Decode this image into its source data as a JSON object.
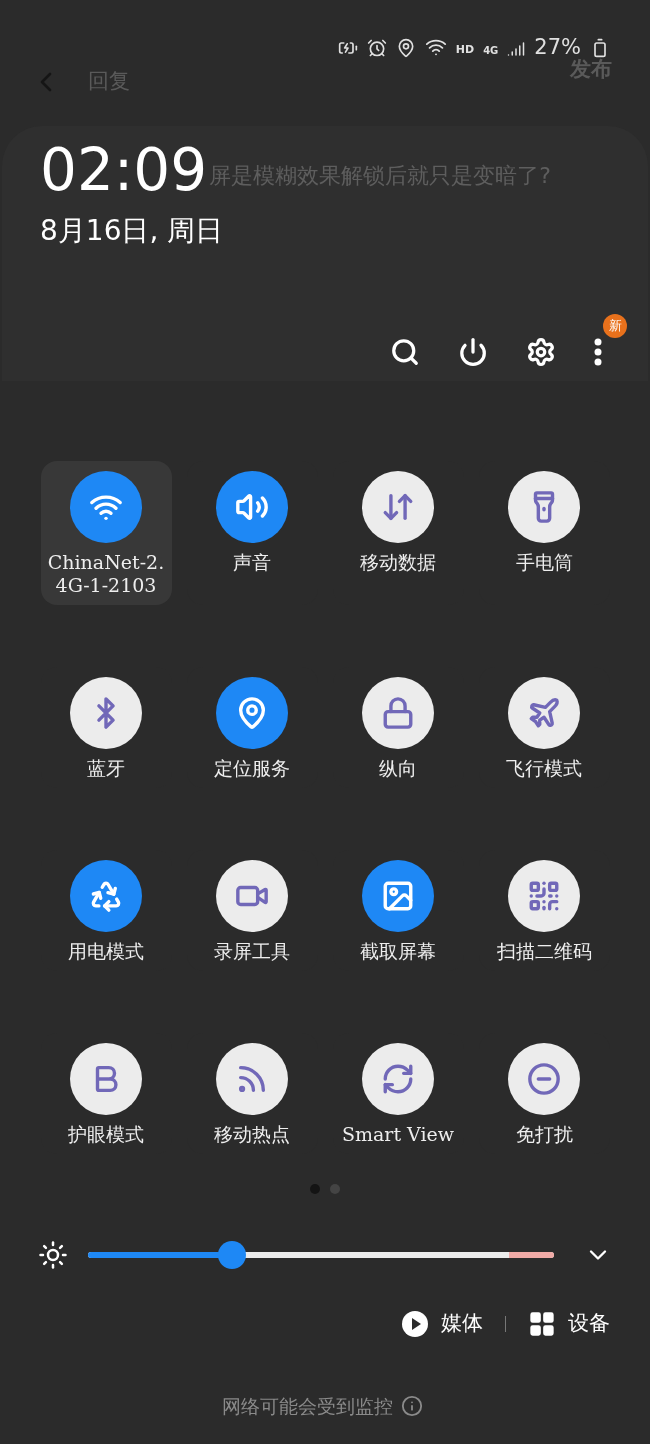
{
  "app_header": {
    "back_label": "回复",
    "publish_label": "发布"
  },
  "status_bar": {
    "hd": "HD",
    "network": "4G",
    "battery": "27%"
  },
  "background_text": "屏是模糊效果解锁后就只是变暗了?",
  "clock": {
    "time": "02:09",
    "date": "8月16日, 周日"
  },
  "toolbar": {
    "badge": "新"
  },
  "tiles": [
    {
      "label": "ChinaNet-2.4G-1-2103",
      "on": true,
      "focused": true
    },
    {
      "label": "声音",
      "on": true,
      "focused": false
    },
    {
      "label": "移动数据",
      "on": false,
      "focused": false
    },
    {
      "label": "手电筒",
      "on": false,
      "focused": false
    },
    {
      "label": "蓝牙",
      "on": false,
      "focused": false
    },
    {
      "label": "定位服务",
      "on": true,
      "focused": false
    },
    {
      "label": "纵向",
      "on": false,
      "focused": false
    },
    {
      "label": "飞行模式",
      "on": false,
      "focused": false
    },
    {
      "label": "用电模式",
      "on": true,
      "focused": false
    },
    {
      "label": "录屏工具",
      "on": false,
      "focused": false
    },
    {
      "label": "截取屏幕",
      "on": true,
      "focused": false
    },
    {
      "label": "扫描二维码",
      "on": false,
      "focused": false
    },
    {
      "label": "护眼模式",
      "on": false,
      "focused": false
    },
    {
      "label": "移动热点",
      "on": false,
      "focused": false
    },
    {
      "label": "Smart View",
      "on": false,
      "focused": false
    },
    {
      "label": "免打扰",
      "on": false,
      "focused": false
    }
  ],
  "pages": [
    {
      "selected": true
    },
    {
      "selected": false
    }
  ],
  "brightness": {
    "level": 0.31
  },
  "media_buttons": [
    {
      "label": "媒体"
    },
    {
      "label": "设备"
    }
  ],
  "footer": {
    "text": "网络可能会受到监控"
  }
}
